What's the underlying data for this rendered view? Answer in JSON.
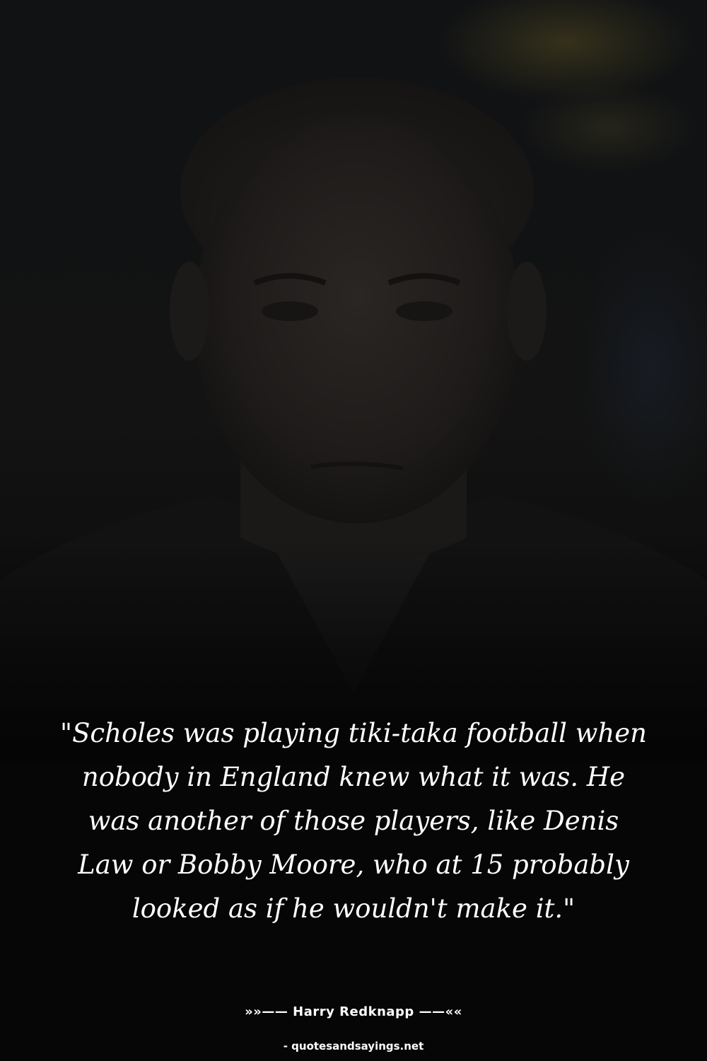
{
  "quote": {
    "text": "\"Scholes was playing tiki-taka football when nobody in England knew what it was. He was another of those players, like Denis Law or Bobby Moore, who at 15 probably looked as if he wouldn't make it.\""
  },
  "author": {
    "line": "»»—— Harry Redknapp ——««"
  },
  "source": {
    "text": "- quotesandsayings.net"
  },
  "colors": {
    "background": "#050505",
    "text": "#ffffff"
  }
}
